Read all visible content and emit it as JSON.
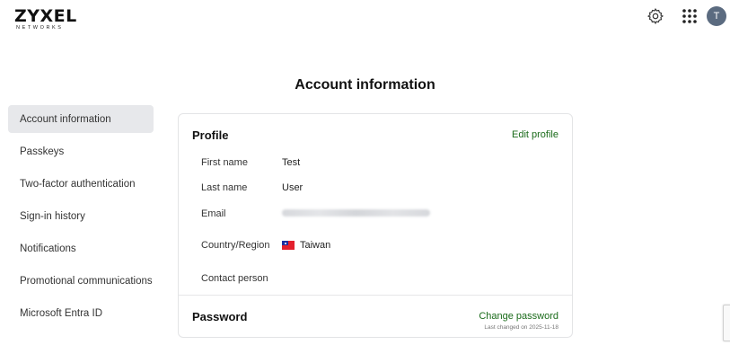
{
  "brand": {
    "name": "ZYXEL",
    "tagline": "NETWORKS"
  },
  "header": {
    "avatar_initial": "T",
    "icons": [
      "gear-icon",
      "apps-grid-icon"
    ]
  },
  "page": {
    "title": "Account information"
  },
  "sidebar": {
    "items": [
      {
        "label": "Account information",
        "active": true
      },
      {
        "label": "Passkeys"
      },
      {
        "label": "Two-factor authentication"
      },
      {
        "label": "Sign-in history"
      },
      {
        "label": "Notifications"
      },
      {
        "label": "Promotional communications"
      },
      {
        "label": "Microsoft Entra ID"
      }
    ]
  },
  "profile": {
    "title": "Profile",
    "edit_label": "Edit profile",
    "fields": {
      "first_name": {
        "label": "First name",
        "value": "Test"
      },
      "last_name": {
        "label": "Last name",
        "value": "User"
      },
      "email": {
        "label": "Email"
      },
      "country": {
        "label": "Country/Region",
        "value": "Taiwan"
      },
      "contact": {
        "label": "Contact person"
      }
    }
  },
  "password": {
    "title": "Password",
    "change_label": "Change password",
    "last_changed": "Last changed on 2025-11-18"
  },
  "colors": {
    "accent_link": "#1a6b1a",
    "active_nav_bg": "#e7e8eb",
    "avatar_bg": "#5b6b80"
  }
}
